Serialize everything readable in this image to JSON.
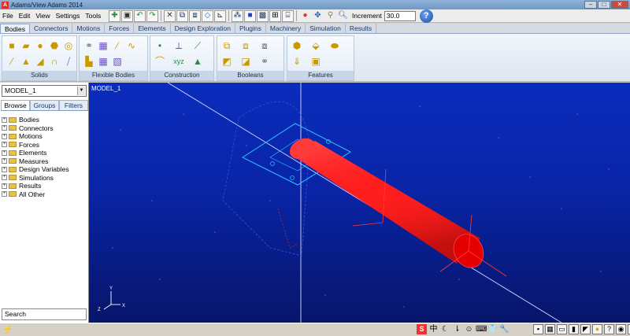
{
  "window": {
    "title": "Adams/View Adams 2014",
    "controls": [
      "–",
      "□",
      "✕"
    ]
  },
  "menu": [
    "File",
    "Edit",
    "View",
    "Settings",
    "Tools"
  ],
  "toolbar": {
    "buttons": [
      "new-icon",
      "save-icon",
      "undo-icon",
      "redo-icon",
      "select-icon",
      "view-front-icon",
      "view-iso-icon",
      "view-cube-icon",
      "axes-icon",
      "grid-icon",
      "render-icon",
      "shade-icon",
      "zoom-fit-icon",
      "zoom-box-icon",
      "record-icon",
      "rotate-icon",
      "zoom-icon",
      "magnify-icon"
    ],
    "increment_label": "Increment",
    "increment_value": "30.0",
    "help_label": "?"
  },
  "ribbon_tabs": [
    "Bodies",
    "Connectors",
    "Motions",
    "Forces",
    "Elements",
    "Design Exploration",
    "Plugins",
    "Machinery",
    "Simulation",
    "Results"
  ],
  "active_tab": "Bodies",
  "ribbon_groups": [
    {
      "label": "Solids",
      "icons": [
        "box-icon",
        "link-icon",
        "sphere-icon",
        "frustum-icon",
        "torus-icon",
        "cylinder-icon",
        "plate-icon",
        "extrusion-icon",
        "revolution-icon",
        "spring-icon"
      ]
    },
    {
      "label": "Flexible Bodies",
      "icons": [
        "flex-link-icon",
        "flex-body-icon",
        "flex-spring-icon",
        "flex-beam-icon",
        "flex-import-icon",
        "flex-mesh-icon",
        "flex-swap-icon"
      ]
    },
    {
      "label": "Construction",
      "icons": [
        "point-icon",
        "marker-icon",
        "polyline-icon",
        "arc-icon",
        "spline-icon",
        "xyz-icon",
        "cone-icon"
      ]
    },
    {
      "label": "Booleans",
      "icons": [
        "union-icon",
        "merge-icon",
        "intersect-icon",
        "cut-icon",
        "split-icon",
        "chain-icon"
      ]
    },
    {
      "label": "Features",
      "icons": [
        "chamfer-icon",
        "hole-icon",
        "boss-icon",
        "fillet-icon",
        "shell-icon",
        "hollow-icon"
      ]
    }
  ],
  "browser": {
    "model": "MODEL_1",
    "tabs": [
      "Browse",
      "Groups",
      "Filters"
    ],
    "active_tab": "Browse",
    "tree": [
      "Bodies",
      "Connectors",
      "Motions",
      "Forces",
      "Elements",
      "Measures",
      "Design Variables",
      "Simulations",
      "Results",
      "All Other"
    ],
    "search_label": "Search"
  },
  "viewport": {
    "model_label": "MODEL_1",
    "triad": {
      "x": "X",
      "y": "Y",
      "z": "Z"
    },
    "colors": {
      "background_top": "#0a2cbd",
      "background_bottom": "#07156a",
      "cylinder": "#ff1a1a",
      "frame": "#2ec7ff"
    }
  },
  "status_icons": [
    "adams-icon"
  ],
  "tray_icons": [
    "S",
    "中",
    "☾",
    "⇂",
    "☺",
    "⌨",
    "👕",
    "🔧"
  ],
  "tray2_icons": [
    "▪",
    "▦",
    "▭",
    "▮",
    "◤",
    "●",
    "?",
    "◉",
    "◎",
    "⏺"
  ]
}
